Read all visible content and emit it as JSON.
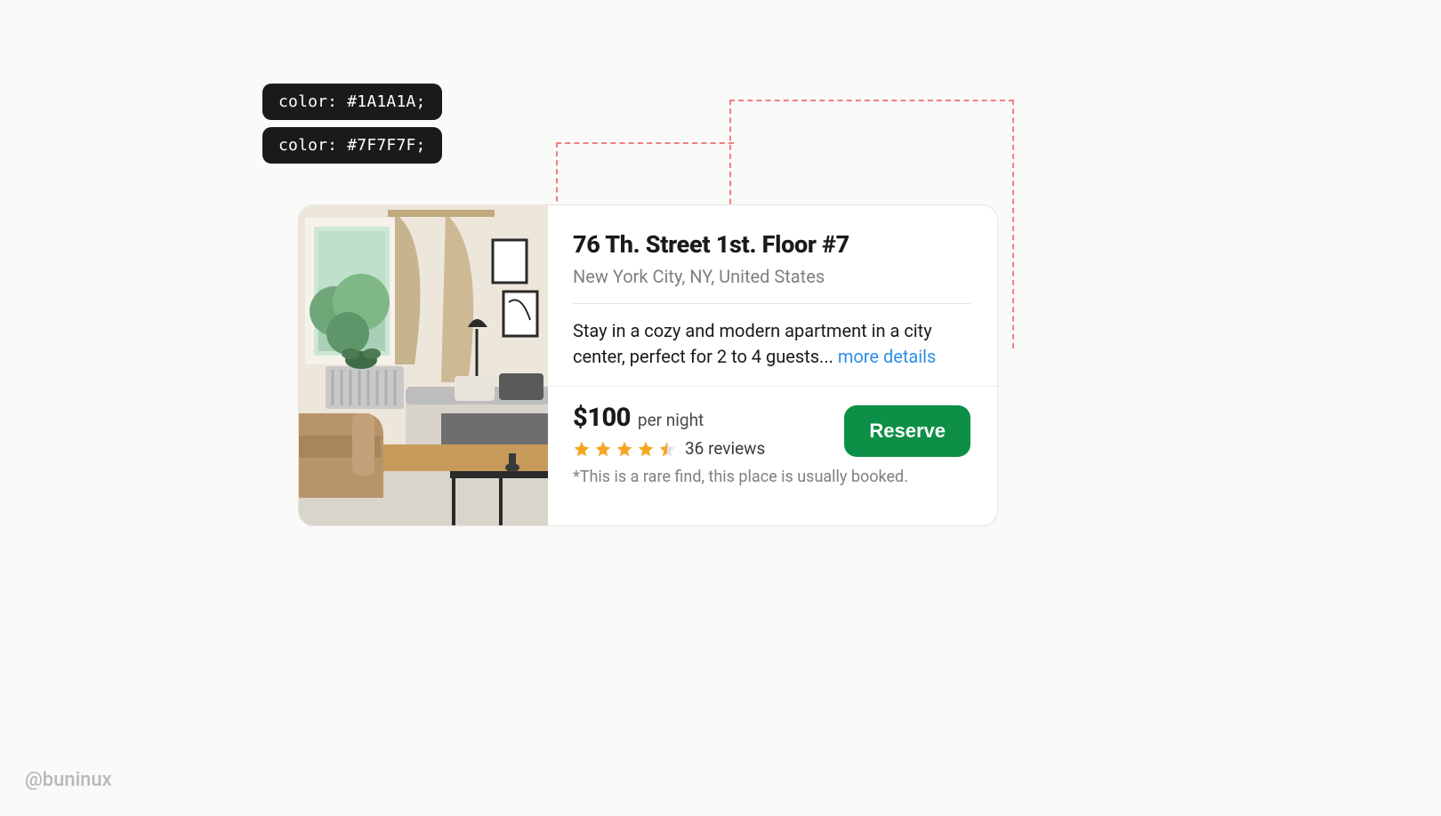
{
  "annotations": {
    "color_label_1": "color: #1A1A1A;",
    "color_label_2": "color: #7F7F7F;"
  },
  "listing": {
    "title": "76 Th. Street 1st. Floor #7",
    "location": "New York City, NY, United States",
    "description": "Stay in a cozy and modern apartment in a city center, perfect for 2 to 4 guests... ",
    "more_link": "more details",
    "price": "$100",
    "per_night": "per night",
    "reviews_text": "36 reviews",
    "rating_stars": 4.5,
    "reserve_label": "Reserve",
    "rare_find": "*This is a rare find, this place is usually booked."
  },
  "handle": "@buninux",
  "colors": {
    "text_primary": "#1A1A1A",
    "text_secondary": "#7F7F7F",
    "link": "#2F8FE6",
    "accent": "#0E8F47",
    "star": "#F5A623",
    "guide": "#F08080"
  }
}
